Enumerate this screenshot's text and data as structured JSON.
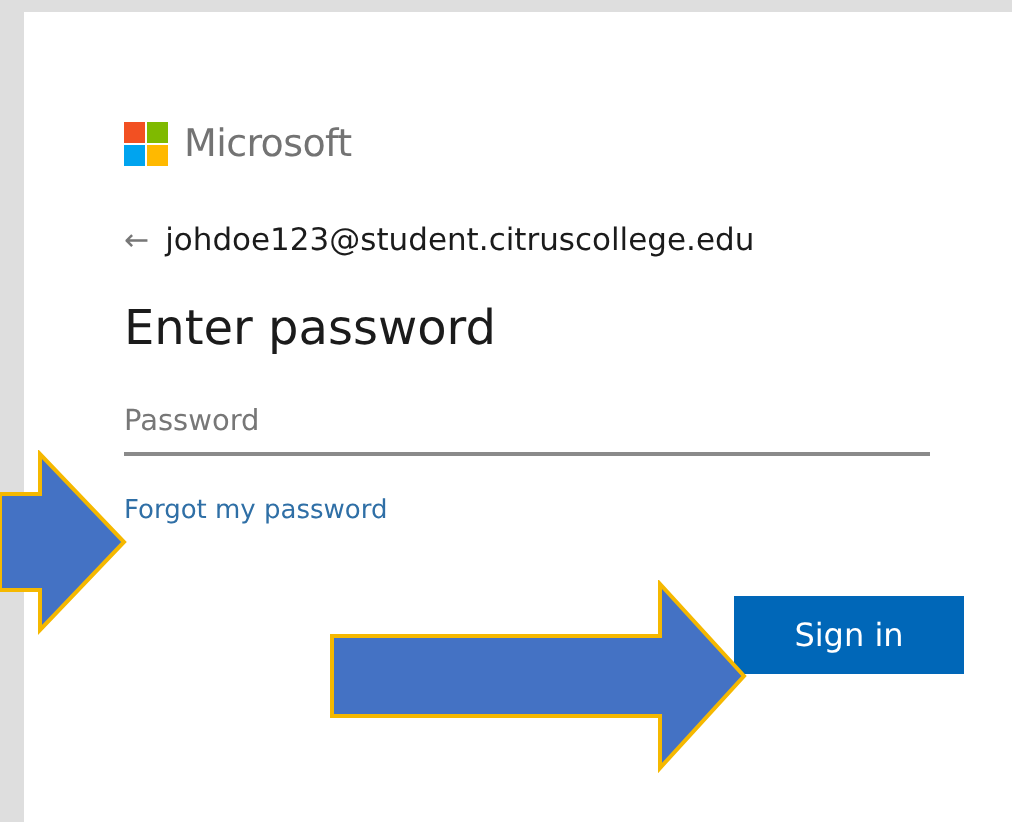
{
  "brand": {
    "name": "Microsoft"
  },
  "account": {
    "back_glyph": "←",
    "email": "johdoe123@student.citruscollege.edu"
  },
  "title": "Enter password",
  "password_field": {
    "placeholder": "Password"
  },
  "forgot_link": {
    "text": "Forgot my password",
    "arrow_pointing": true
  },
  "sign_in_button": {
    "text": "Sign in",
    "arrow_pointing": true
  }
}
